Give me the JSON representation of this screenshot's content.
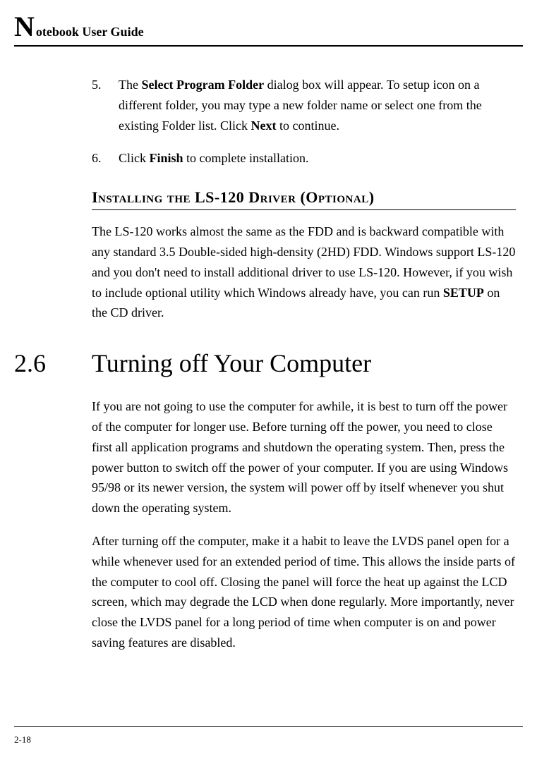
{
  "header": {
    "dropcap": "N",
    "rest": "otebook User Guide"
  },
  "items": [
    {
      "num": "5.",
      "prefix": "The ",
      "bold1": "Select Program Folder",
      "mid1": " dialog box will appear. To setup icon on a different folder, you may type a new folder name or select one from the existing Folder list. Click ",
      "bold2": "Next",
      "suffix": " to continue."
    },
    {
      "num": "6.",
      "prefix": "Click ",
      "bold1": "Finish",
      "mid1": " to complete installation.",
      "bold2": "",
      "suffix": ""
    }
  ],
  "subheading": "Installing the LS-120 Driver (Optional)",
  "para1_prefix": "The LS-120 works almost the same as the FDD and is backward compatible with any standard 3.5 Double-sided high-density (2HD) FDD. Windows support LS-120 and you don't need to install additional driver to use LS-120. However, if you wish to include optional utility which Windows already have, you can run ",
  "para1_bold": "SETUP",
  "para1_suffix": " on the CD driver.",
  "section_num": "2.6",
  "section_title": "Turning off Your Computer",
  "para2": "If you are not going to use the computer for awhile, it is best to turn off the power of the computer for longer use. Before turning off the power, you need to close first all application programs and shutdown the operating system. Then, press the power button to switch off the power of your computer. If you are using Windows 95/98 or its newer version, the system will power off by itself whenever you shut down the operating system.",
  "para3": "After turning off the computer, make it a habit to leave the LVDS panel open for a while whenever used for an extended period of time. This allows the inside parts of the computer to cool off. Closing the panel will force the heat up against the LCD screen, which may degrade the LCD when done regularly. More importantly, never close the LVDS panel for a long period of time when computer is on and power saving features are disabled.",
  "page_num": "2-18"
}
